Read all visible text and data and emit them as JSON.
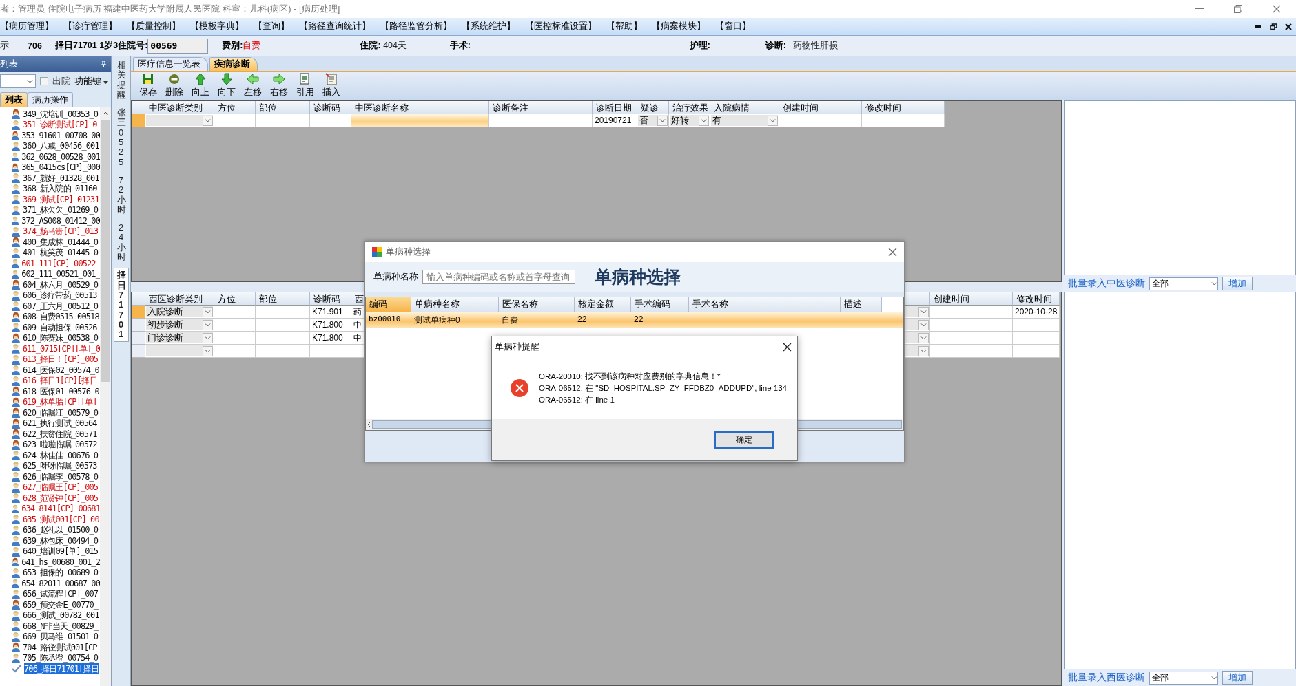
{
  "window": {
    "title": "者：管理员 住院电子病历  福建中医药大学附属人民医院  科室：儿科(病区) - [病历处理]"
  },
  "menu": [
    "【病历管理】",
    "【诊疗管理】",
    "【质量控制】",
    "【模板字典】",
    "【查询】",
    "【路径查询统计】",
    "【路径监管分析】",
    "【系统维护】",
    "【医控标准设置】",
    "【帮助】",
    "【病案模块】",
    "【窗口】"
  ],
  "patient_bar": {
    "cut_label": "示",
    "bed": "706",
    "name_age": "择日71701 1岁3",
    "admission_no_label": "住院号:",
    "admission_no": "00569",
    "fee_label": "费别:",
    "fee": "自费",
    "stay_label": "住院:",
    "stay": "404天",
    "surgery_label": "手术:",
    "nursing_label": "护理:",
    "diagnosis_label": "诊断:",
    "diagnosis": "药物性肝损"
  },
  "left_panel": {
    "title": "列表",
    "discharged": {
      "label": "出院",
      "checked": false
    },
    "function_key": "功能键",
    "tabs": [
      {
        "label": "列表",
        "selected": true
      },
      {
        "label": "病历操作",
        "selected": false
      }
    ],
    "patients": [
      {
        "label": "349_沈培训_00353_0",
        "kind": "female",
        "highlighted": false,
        "selected": false
      },
      {
        "label": "351_诊断测试[CP]_0",
        "kind": "male",
        "highlighted": true,
        "selected": false
      },
      {
        "label": "353_91601_00708_00",
        "kind": "female",
        "highlighted": false,
        "selected": false
      },
      {
        "label": "360_八戒_00456_001",
        "kind": "male",
        "highlighted": false,
        "selected": false
      },
      {
        "label": "362_0628_00528_001",
        "kind": "male",
        "highlighted": false,
        "selected": false
      },
      {
        "label": "365_0415cs[CP]_000",
        "kind": "female",
        "highlighted": false,
        "selected": false
      },
      {
        "label": "367_就好_01328_001",
        "kind": "male",
        "highlighted": false,
        "selected": false
      },
      {
        "label": "368_新入院的_01160",
        "kind": "male",
        "highlighted": false,
        "selected": false
      },
      {
        "label": "369_测试[CP]_01231",
        "kind": "male",
        "highlighted": true,
        "selected": false
      },
      {
        "label": "371_林欠欠_01269_0",
        "kind": "male",
        "highlighted": false,
        "selected": false
      },
      {
        "label": "372_AS008_01412_00",
        "kind": "male",
        "highlighted": false,
        "selected": false
      },
      {
        "label": "374_杨马贵[CP]_013",
        "kind": "male",
        "highlighted": true,
        "selected": false
      },
      {
        "label": "400_集成林_01444_0",
        "kind": "female",
        "highlighted": false,
        "selected": false
      },
      {
        "label": "401_杭笑茂_01445_0",
        "kind": "male",
        "highlighted": false,
        "selected": false
      },
      {
        "label": "601_111[CP]_00522_",
        "kind": "male",
        "highlighted": true,
        "selected": false
      },
      {
        "label": "602_111_00521_001_",
        "kind": "male",
        "highlighted": false,
        "selected": false
      },
      {
        "label": "604_林六月_00529_0",
        "kind": "female",
        "highlighted": false,
        "selected": false
      },
      {
        "label": "606_诊疗带药_00513",
        "kind": "male",
        "highlighted": false,
        "selected": false
      },
      {
        "label": "607_王六月_00512_0",
        "kind": "male",
        "highlighted": false,
        "selected": false
      },
      {
        "label": "608_自费0515_00518",
        "kind": "female",
        "highlighted": false,
        "selected": false
      },
      {
        "label": "609_自动担保_00526",
        "kind": "male",
        "highlighted": false,
        "selected": false
      },
      {
        "label": "610_陈赛妹_00538_0",
        "kind": "female",
        "highlighted": false,
        "selected": false
      },
      {
        "label": "611_0715[CP][单]_0",
        "kind": "male",
        "highlighted": true,
        "selected": false
      },
      {
        "label": "613_择日！[CP]_005",
        "kind": "male",
        "highlighted": true,
        "selected": false
      },
      {
        "label": "614_医保02_00574_0",
        "kind": "male",
        "highlighted": false,
        "selected": false
      },
      {
        "label": "616_择日1[CP][择日",
        "kind": "male",
        "highlighted": true,
        "selected": false
      },
      {
        "label": "618_医保01_00576_0",
        "kind": "female",
        "highlighted": false,
        "selected": false
      },
      {
        "label": "619_林单胎[CP][单]",
        "kind": "female",
        "highlighted": true,
        "selected": false
      },
      {
        "label": "620_临嘱江_00579_0",
        "kind": "female",
        "highlighted": false,
        "selected": false
      },
      {
        "label": "621_执行测试_00564",
        "kind": "female",
        "highlighted": false,
        "selected": false
      },
      {
        "label": "622_扶贫住院_00571",
        "kind": "female",
        "highlighted": false,
        "selected": false
      },
      {
        "label": "623_啦啦临嘱_00572",
        "kind": "female",
        "highlighted": false,
        "selected": false
      },
      {
        "label": "624_林佳佳_00676_0",
        "kind": "male",
        "highlighted": false,
        "selected": false
      },
      {
        "label": "625_呀呀临嘱_00573",
        "kind": "male",
        "highlighted": false,
        "selected": false
      },
      {
        "label": "626_临嘱李_00578_0",
        "kind": "male",
        "highlighted": false,
        "selected": false
      },
      {
        "label": "627_临嘱王[CP]_005",
        "kind": "male",
        "highlighted": true,
        "selected": false
      },
      {
        "label": "628_范贤钟[CP]_005",
        "kind": "male",
        "highlighted": true,
        "selected": false
      },
      {
        "label": "634_8141[CP]_00681",
        "kind": "male",
        "highlighted": true,
        "selected": false
      },
      {
        "label": "635_测试001[CP]_00",
        "kind": "male",
        "highlighted": true,
        "selected": false
      },
      {
        "label": "636_赵礼以_01500_0",
        "kind": "male",
        "highlighted": false,
        "selected": false
      },
      {
        "label": "639_林包床_00494_0",
        "kind": "male",
        "highlighted": false,
        "selected": false
      },
      {
        "label": "640_培训09[单]_015",
        "kind": "male",
        "highlighted": false,
        "selected": false
      },
      {
        "label": "641_hs_00680_001_2",
        "kind": "female",
        "highlighted": false,
        "selected": false
      },
      {
        "label": "653_担保的_00689_0",
        "kind": "male",
        "highlighted": false,
        "selected": false
      },
      {
        "label": "654_82011_00687_00",
        "kind": "male",
        "highlighted": false,
        "selected": false
      },
      {
        "label": "656_试流程[CP]_007",
        "kind": "male",
        "highlighted": false,
        "selected": false
      },
      {
        "label": "659_预交金E_00770_",
        "kind": "female",
        "highlighted": false,
        "selected": false
      },
      {
        "label": "666_测试_00782_001",
        "kind": "male",
        "highlighted": false,
        "selected": false
      },
      {
        "label": "668_N非当天_00829_",
        "kind": "male",
        "highlighted": false,
        "selected": false
      },
      {
        "label": "669_贝马维_01501_0",
        "kind": "male",
        "highlighted": false,
        "selected": false
      },
      {
        "label": "704_路径测试001[CP",
        "kind": "female",
        "highlighted": false,
        "selected": false
      },
      {
        "label": "705_陈丞澄_00754_0",
        "kind": "male",
        "highlighted": false,
        "selected": false
      },
      {
        "label": "706_择日71701[择日",
        "kind": "check",
        "highlighted": false,
        "selected": true
      }
    ]
  },
  "side_tabs": [
    {
      "label": "相关提醒",
      "selected": false
    },
    {
      "label": "张三0525",
      "selected": false
    },
    {
      "label": "72小时",
      "selected": false
    },
    {
      "label": "24小时",
      "selected": false
    },
    {
      "label": "择日71701",
      "selected": true
    }
  ],
  "doc_tabs": [
    {
      "label": "医疗信息一览表",
      "selected": false
    },
    {
      "label": "疾病诊断",
      "selected": true
    }
  ],
  "toolbar": [
    {
      "label": "保存",
      "kind": "save"
    },
    {
      "label": "删除",
      "kind": "delete"
    },
    {
      "label": "向上",
      "kind": "up"
    },
    {
      "label": "向下",
      "kind": "down"
    },
    {
      "label": "左移",
      "kind": "left"
    },
    {
      "label": "右移",
      "kind": "right"
    },
    {
      "label": "引用",
      "kind": "cite"
    },
    {
      "label": "插入",
      "kind": "insert"
    }
  ],
  "tcm_grid": {
    "columns": [
      "中医诊断类别",
      "方位",
      "部位",
      "诊断码",
      "中医诊断名称",
      "诊断备注",
      "诊断日期",
      "疑诊",
      "治疗效果",
      "入院病情",
      "创建时间",
      "修改时间"
    ],
    "rows": [
      {
        "selected": true,
        "cells": [
          {
            "kind": "dropdown"
          },
          {
            "kind": "text"
          },
          {
            "kind": "text"
          },
          {
            "kind": "text"
          },
          {
            "kind": "focus"
          },
          {
            "kind": "text"
          },
          {
            "kind": "text",
            "text": "20190721"
          },
          {
            "kind": "dropdown",
            "text": "否"
          },
          {
            "kind": "dropdown",
            "text": "好转"
          },
          {
            "kind": "dropdown",
            "text": "有"
          },
          {
            "kind": "text"
          },
          {
            "kind": "text"
          }
        ]
      }
    ]
  },
  "western_grid": {
    "columns": [
      "西医诊断类别",
      "方位",
      "部位",
      "诊断码",
      "西",
      "创建时间",
      "修改时间"
    ],
    "rows": [
      {
        "selected": true,
        "cells": [
          {
            "kind": "dropdown",
            "text": "入院诊断"
          },
          {
            "kind": "text"
          },
          {
            "kind": "text"
          },
          {
            "kind": "text",
            "text": "K71.901"
          },
          {
            "kind": "text",
            "text": "药"
          },
          {
            "kind": "dropdown"
          },
          {
            "kind": "text"
          },
          {
            "kind": "text",
            "text": "2020-10-28"
          }
        ]
      },
      {
        "selected": false,
        "cells": [
          {
            "kind": "dropdown",
            "text": "初步诊断"
          },
          {
            "kind": "text"
          },
          {
            "kind": "text"
          },
          {
            "kind": "text",
            "text": "K71.800"
          },
          {
            "kind": "text",
            "text": "中"
          },
          {
            "kind": "dropdown"
          },
          {
            "kind": "text"
          },
          {
            "kind": "text"
          }
        ]
      },
      {
        "selected": false,
        "cells": [
          {
            "kind": "dropdown",
            "text": "门诊诊断"
          },
          {
            "kind": "text"
          },
          {
            "kind": "text"
          },
          {
            "kind": "text",
            "text": "K71.800"
          },
          {
            "kind": "text",
            "text": "中"
          },
          {
            "kind": "dropdown"
          },
          {
            "kind": "text"
          },
          {
            "kind": "text"
          }
        ]
      },
      {
        "selected": false,
        "cells": [
          {
            "kind": "dropdown"
          },
          {
            "kind": "text"
          },
          {
            "kind": "text"
          },
          {
            "kind": "text"
          },
          {
            "kind": "text"
          },
          {
            "kind": "dropdown"
          },
          {
            "kind": "text"
          },
          {
            "kind": "text"
          }
        ]
      }
    ]
  },
  "right_panel": {
    "tcm_batch": {
      "label": "批量录入中医诊断",
      "select": "全部",
      "button": "增加"
    },
    "western_batch": {
      "label": "批量录入西医诊断",
      "select": "全部",
      "button": "增加"
    }
  },
  "select_dialog": {
    "title": "单病种选择",
    "search_label": "单病种名称",
    "search_placeholder": "输入单病种编码或名称或首字母查询",
    "heading": "单病种选择",
    "columns": [
      {
        "label": "编码",
        "selected": true
      },
      {
        "label": "单病种名称",
        "selected": false
      },
      {
        "label": "医保名称",
        "selected": false
      },
      {
        "label": "核定金额",
        "selected": false
      },
      {
        "label": "手术编码",
        "selected": false
      },
      {
        "label": "手术名称",
        "selected": false
      },
      {
        "label": "描述",
        "selected": false
      }
    ],
    "rows": [
      {
        "selected": true,
        "cells": [
          "bz00010",
          "测试单病种0",
          "自费",
          "22",
          "22"
        ]
      }
    ]
  },
  "alert_dialog": {
    "title": "单病种提醒",
    "lines": [
      "ORA-20010: 找不到该病种对应费别的字典信息！*",
      "ORA-06512: 在 \"SD_HOSPITAL.SP_ZY_FFDBZ0_ADDUPD\", line 134",
      "ORA-06512: 在 line 1"
    ],
    "button": "确定"
  }
}
